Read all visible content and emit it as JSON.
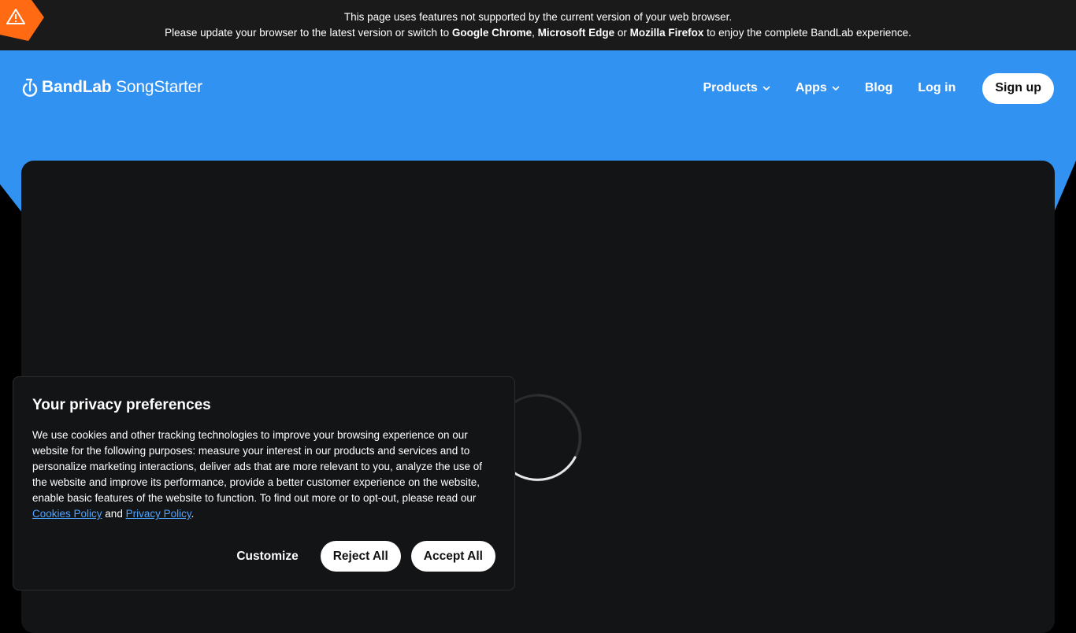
{
  "warning": {
    "line1": "This page uses features not supported by the current version of your web browser.",
    "line2_pre": "Please update your browser to the latest version or switch to ",
    "browser1": "Google Chrome",
    "sep1": ", ",
    "browser2": "Microsoft Edge",
    "sep2": " or ",
    "browser3": "Mozilla Firefox",
    "line2_post": " to enjoy the complete BandLab experience.",
    "icon": "warning-triangle-icon"
  },
  "header": {
    "logo_brand": "BandLab",
    "logo_product": " SongStarter",
    "nav": {
      "products": "Products",
      "apps": "Apps",
      "blog": "Blog",
      "login": "Log in",
      "signup": "Sign up"
    }
  },
  "cookie": {
    "title": "Your privacy preferences",
    "body_pre": "We use cookies and other tracking technologies to improve your browsing experience on our website for the following purposes: measure your interest in our products and services and to personalize marketing interactions, deliver ads that are more relevant to you, analyze the use of the website and improve its performance, provide a better customer experience on the website, enable basic features of the website to function. To find out more or to opt-out, please read our ",
    "cookies_link": "Cookies Policy",
    "body_mid": " and ",
    "privacy_link": "Privacy Policy",
    "body_end": ".",
    "customize": "Customize",
    "reject": "Reject All",
    "accept": "Accept All"
  },
  "colors": {
    "brand_blue": "#3192f2",
    "warning_orange": "#ff6a13",
    "link_blue": "#4fa3ff"
  }
}
